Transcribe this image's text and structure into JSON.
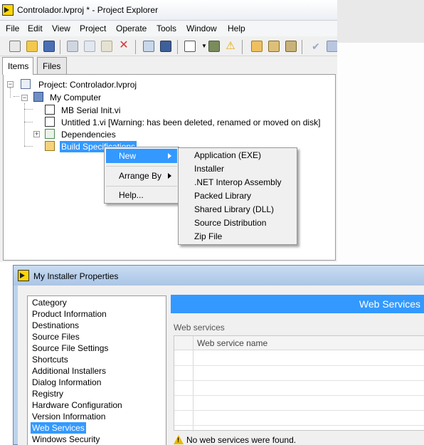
{
  "project_explorer": {
    "title": "Controlador.lvproj * - Project Explorer",
    "menu": [
      "File",
      "Edit",
      "View",
      "Project",
      "Operate",
      "Tools",
      "Window",
      "Help"
    ],
    "tabs": [
      "Items",
      "Files"
    ],
    "tree": {
      "project": "Project: Controlador.lvproj",
      "computer": "My Computer",
      "items": [
        "MB Serial Init.vi",
        "Untitled 1.vi  [Warning:  has been deleted, renamed or moved on disk]",
        "Dependencies",
        "Build Specifications"
      ]
    },
    "context_menu": {
      "items": [
        "New",
        "Arrange By",
        "Help..."
      ],
      "submenu": [
        "Application (EXE)",
        "Installer",
        ".NET Interop Assembly",
        "Packed Library",
        "Shared Library (DLL)",
        "Source Distribution",
        "Zip File"
      ]
    }
  },
  "installer_properties": {
    "title": "My Installer Properties",
    "category_header": "Category",
    "categories": [
      "Product Information",
      "Destinations",
      "Source Files",
      "Source File Settings",
      "Shortcuts",
      "Additional Installers",
      "Dialog Information",
      "Registry",
      "Hardware Configuration",
      "Version Information",
      "Web Services",
      "Windows Security"
    ],
    "selected_category": "Web Services",
    "panel_header": "Web Services",
    "section_label": "Web services",
    "table_header": "Web service name",
    "warning": "No web services were found."
  },
  "colors": {
    "selection": "#3399ff",
    "warning": "#e8b800"
  }
}
